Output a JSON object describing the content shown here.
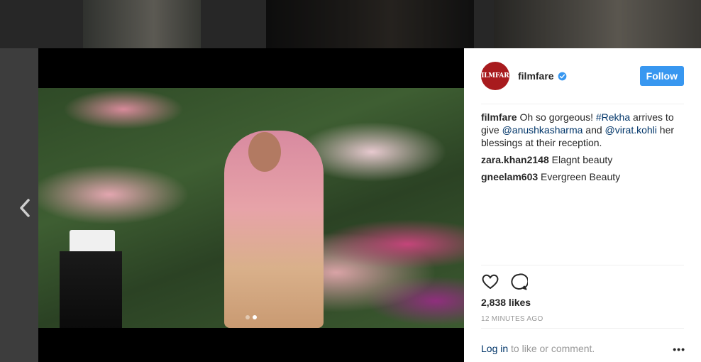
{
  "background": {
    "thumbnails": [
      "thumbnail-1",
      "thumbnail-2",
      "thumbnail-3"
    ]
  },
  "nav": {
    "prev_icon": "chevron-left-icon"
  },
  "post": {
    "carousel": {
      "count": 2,
      "active_index": 1
    },
    "author": {
      "avatar_text": "FILMFARE",
      "username": "filmfare",
      "verified_icon": "verified-badge-icon"
    },
    "follow_label": "Follow",
    "caption": {
      "username": "filmfare",
      "text_1": " Oh so gorgeous! ",
      "hashtag": "#Rekha",
      "text_2": " arrives to give ",
      "mention_1": "@anushkasharma",
      "text_3": " and ",
      "mention_2": "@virat.kohli",
      "text_4": " her blessings at their reception."
    },
    "comments": [
      {
        "username": "zara.khan2148",
        "text": " Elagnt beauty"
      },
      {
        "username": "gneelam603",
        "text": " Evergreen Beauty"
      }
    ],
    "likes": "2,838 likes",
    "time": "12 MINUTES AGO",
    "login": {
      "link": "Log in",
      "text": " to like or comment."
    },
    "more": "•••"
  },
  "colors": {
    "follow_button": "#3897f0",
    "link": "#003569",
    "avatar": "#a81b1e",
    "overlay": "#3d3d3d"
  }
}
